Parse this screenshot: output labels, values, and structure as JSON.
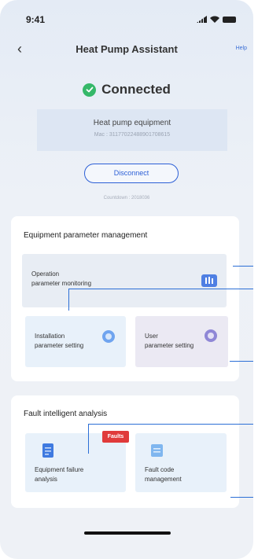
{
  "status": {
    "time": "9:41"
  },
  "nav": {
    "title": "Heat Pump Assistant",
    "help": "Help"
  },
  "connection": {
    "status": "Connected",
    "device": "Heat pump equipment",
    "mac": "Mac : 31177022488901708615"
  },
  "disconnect_label": "Disconnect",
  "countdown": "Countdown : 2018036",
  "param_section": {
    "title": "Equipment parameter management",
    "operation": {
      "line1": "Operation",
      "line2": "parameter monitoring"
    },
    "installation": {
      "line1": "Installation",
      "line2": "parameter setting"
    },
    "user": {
      "line1": "User",
      "line2": "parameter setting"
    }
  },
  "fault_section": {
    "title": "Fault intelligent analysis",
    "badge": "Faults",
    "failure": {
      "line1": "Equipment failure",
      "line2": "analysis"
    },
    "code": {
      "line1": "Fault code",
      "line2": "management"
    }
  },
  "colors": {
    "accent": "#2c5fd6",
    "success": "#35b869",
    "badge": "#e03a3a"
  }
}
